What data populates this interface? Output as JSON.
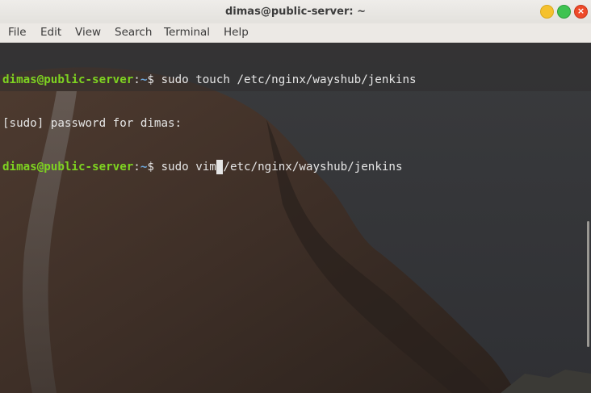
{
  "window": {
    "title": "dimas@public-server: ~",
    "buttons": {
      "minimize": "minimize",
      "maximize": "maximize",
      "close": "×"
    }
  },
  "menu": [
    "File",
    "Edit",
    "View",
    "Search",
    "Terminal",
    "Help"
  ],
  "terminal": {
    "lines": [
      {
        "user": "dimas@public-server",
        "sep": ":",
        "path": "~",
        "prompt": "$ ",
        "command": "sudo touch /etc/nginx/wayshub/jenkins"
      },
      {
        "text": "[sudo] password for dimas:"
      },
      {
        "user": "dimas@public-server",
        "sep": ":",
        "path": "~",
        "prompt": "$ ",
        "command_before_cursor": "sudo vim",
        "cursor_char": " ",
        "command_after_cursor": "/etc/nginx/wayshub/jenkins"
      }
    ]
  },
  "colors": {
    "prompt_user": "#7ed321",
    "prompt_path": "#6fa8dc",
    "text": "#e6e6e6"
  }
}
